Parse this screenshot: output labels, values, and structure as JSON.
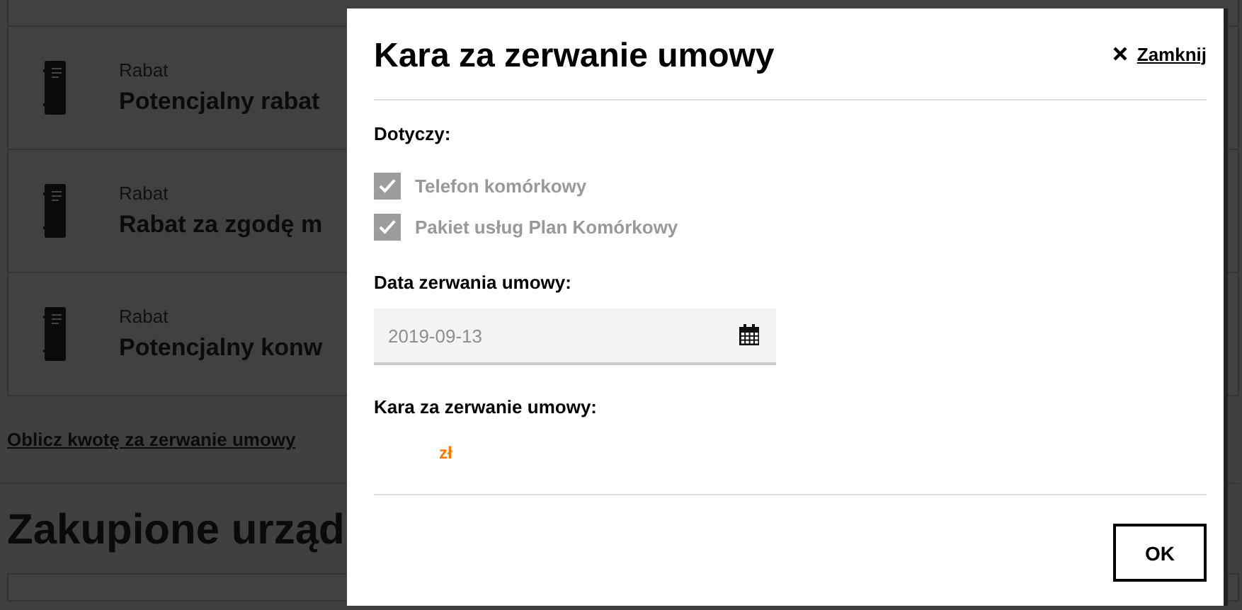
{
  "background": {
    "cards": [
      {
        "category": "Rabat",
        "title": "Potencjalny rabat"
      },
      {
        "category": "Rabat",
        "title": "Rabat za zgodę m"
      },
      {
        "category": "Rabat",
        "title": "Potencjalny konw"
      }
    ],
    "link": "Oblicz kwotę za zerwanie umowy",
    "heading": "Zakupione urząd"
  },
  "dialog": {
    "title": "Kara za zerwanie umowy",
    "close_label": "Zamknij",
    "applies_label": "Dotyczy:",
    "items": [
      {
        "label": "Telefon komórkowy",
        "checked": true,
        "disabled": true
      },
      {
        "label": "Pakiet usług Plan Komórkowy",
        "checked": true,
        "disabled": true
      }
    ],
    "date_label": "Data zerwania umowy:",
    "date_value": "2019-09-13",
    "date_disabled": true,
    "penalty_label": "Kara za zerwanie umowy:",
    "penalty_currency": "zł",
    "ok": "OK"
  }
}
